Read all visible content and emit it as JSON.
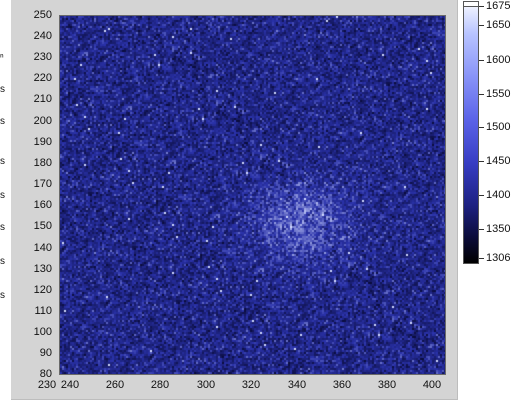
{
  "left_clip_labels": [
    "ⁿ",
    "s",
    "s",
    "s",
    "s",
    "s",
    "s",
    "s"
  ],
  "plot": {
    "y_ticks": [
      "250",
      "240",
      "230",
      "220",
      "210",
      "200",
      "190",
      "180",
      "170",
      "160",
      "150",
      "140",
      "130",
      "120",
      "110",
      "100",
      "90",
      "80"
    ],
    "x_ticks": [
      "230",
      "240",
      "260",
      "280",
      "300",
      "320",
      "340",
      "360",
      "380",
      "400"
    ],
    "x_range": [
      230,
      400
    ],
    "y_range": [
      80,
      250
    ],
    "hot_spot": {
      "x": 337,
      "y": 153
    },
    "colors": {
      "frame": "#d4d4d4",
      "field_mean": "#2a2f9a"
    }
  },
  "colorbar": {
    "labels": [
      "1675",
      "1650",
      "1600",
      "1550",
      "1500",
      "1450",
      "1400",
      "1350",
      "1306"
    ],
    "min": 1306,
    "max": 1675
  }
}
